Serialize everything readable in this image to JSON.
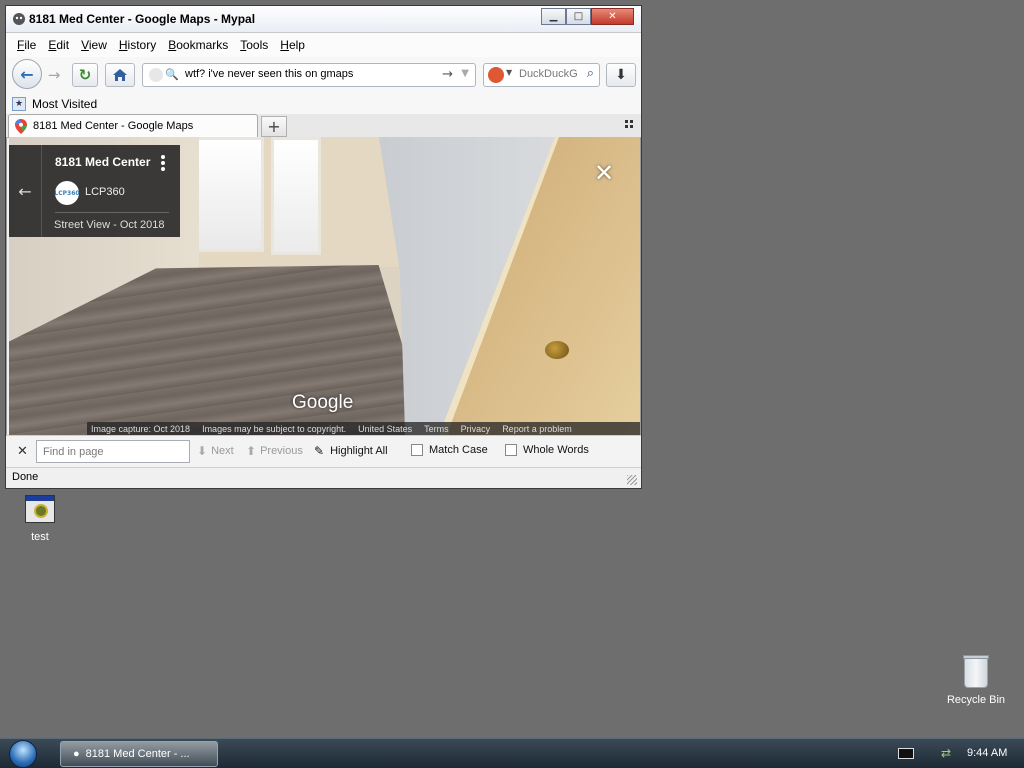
{
  "window": {
    "title": "8181 Med Center - Google Maps - Mypal",
    "controls": {
      "minimize_icon": "minimize-icon",
      "maximize_icon": "maximize-icon",
      "close_icon": "close-icon"
    }
  },
  "menubar": {
    "items": [
      {
        "label": "File",
        "accesskey": "F",
        "rest": "ile"
      },
      {
        "label": "Edit",
        "accesskey": "E",
        "rest": "dit"
      },
      {
        "label": "View",
        "accesskey": "V",
        "rest": "iew"
      },
      {
        "label": "History",
        "accesskey": "H",
        "rest": "istory"
      },
      {
        "label": "Bookmarks",
        "accesskey": "B",
        "rest": "ookmarks"
      },
      {
        "label": "Tools",
        "accesskey": "T",
        "rest": "ools"
      },
      {
        "label": "Help",
        "accesskey": "H",
        "rest": "elp"
      }
    ]
  },
  "navbar": {
    "url": "wtf? i've never seen this on gmaps",
    "search_engine": "DuckDuckGo",
    "search_placeholder": "DuckDuckGo"
  },
  "bookmarks": {
    "most_visited": "Most Visited"
  },
  "tabs": [
    {
      "label": "8181 Med Center - Google Maps"
    }
  ],
  "streetview": {
    "place_title": "8181 Med Center",
    "author": "LCP360",
    "author_avatar_text": "LCP360",
    "subtitle": "Street View - Oct 2018",
    "google_logo": "Google",
    "attribution": [
      "Image capture: Oct 2018",
      "Images may be subject to copyright.",
      "United States",
      "Terms",
      "Privacy",
      "Report a problem"
    ]
  },
  "findbar": {
    "placeholder": "Find in page",
    "next": "Next",
    "previous": "Previous",
    "highlight_all": "Highlight All",
    "match_case": "Match Case",
    "whole_words": "Whole Words"
  },
  "status": {
    "text": "Done"
  },
  "desktop": {
    "icons": [
      {
        "label": "test"
      },
      {
        "label": "Recycle Bin"
      }
    ]
  },
  "taskbar": {
    "task": "8181 Med Center - ...",
    "clock": "9:44 AM"
  },
  "colors": {
    "desktop": "#6e6e6e",
    "accent": "#2d6db5",
    "ddg": "#de5833"
  }
}
